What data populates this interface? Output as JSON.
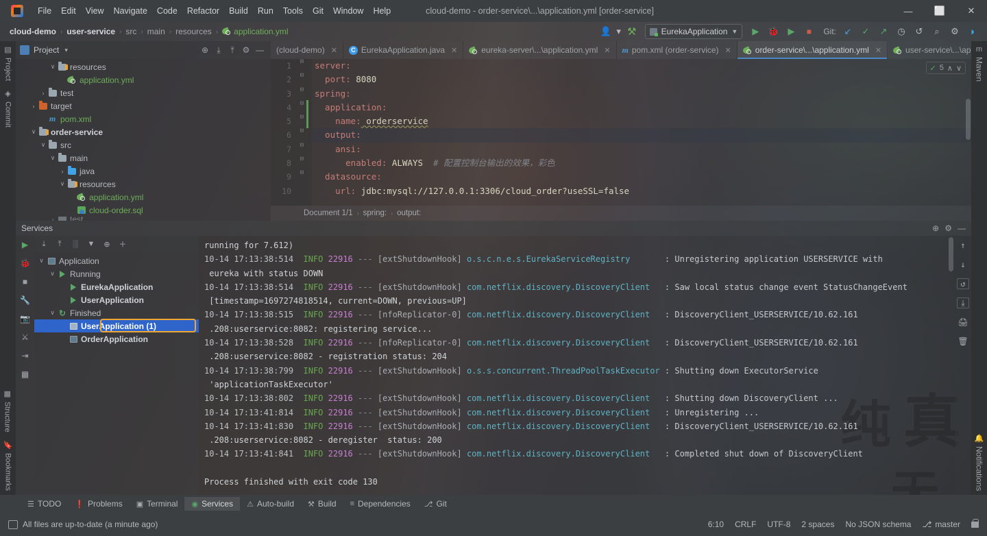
{
  "window": {
    "title": "cloud-demo - order-service\\...\\application.yml [order-service]",
    "minimize": "—",
    "maximize": "⬜",
    "close": "✕"
  },
  "menu": {
    "items": [
      "File",
      "Edit",
      "View",
      "Navigate",
      "Code",
      "Refactor",
      "Build",
      "Run",
      "Tools",
      "Git",
      "Window",
      "Help"
    ]
  },
  "navbar": {
    "breadcrumbs": [
      "cloud-demo",
      "user-service",
      "src",
      "main",
      "resources",
      "application.yml"
    ],
    "separator": "›",
    "run_config": "EurekaApplication",
    "run_config_caret": "▼",
    "git_label": "Git:",
    "icons": {
      "profile": "👤",
      "profile_caret": "▾",
      "hammer": "⚒",
      "run": "▶",
      "debug": "🐞",
      "run_coverage": "▶",
      "stop": "■",
      "update_project": "↙",
      "commit": "✓",
      "push": "↗",
      "history": "◷",
      "rollback": "↺",
      "search": "⌕",
      "settings": "⚙",
      "ide_widget": "◗"
    }
  },
  "left_strip": {
    "items": [
      {
        "label": "Project",
        "icon": "▤"
      },
      {
        "label": "Commit",
        "icon": "◈"
      },
      {
        "label": "Structure",
        "icon": "▦"
      },
      {
        "label": "Bookmarks",
        "icon": "🔖"
      }
    ]
  },
  "right_strip": {
    "items": [
      {
        "label": "Maven",
        "icon": "m"
      },
      {
        "label": "Notifications",
        "icon": "🔔"
      }
    ]
  },
  "project_panel": {
    "title": "Project",
    "caret": "▾",
    "header_icons": [
      "⊕",
      "⤓",
      "⤒",
      "⚙",
      "—"
    ],
    "tree": [
      {
        "indent": 3,
        "twist": "∨",
        "icon": "resources",
        "label": "resources",
        "style": "normal"
      },
      {
        "indent": 4,
        "twist": "",
        "icon": "yml",
        "label": "application.yml",
        "style": "green"
      },
      {
        "indent": 2,
        "twist": "›",
        "icon": "folder",
        "label": "test",
        "style": "normal"
      },
      {
        "indent": 1,
        "twist": "›",
        "icon": "folder-orange",
        "label": "target",
        "style": "normal"
      },
      {
        "indent": 2,
        "twist": "",
        "icon": "maven",
        "label": "pom.xml",
        "style": "green"
      },
      {
        "indent": 1,
        "twist": "∨",
        "icon": "module",
        "label": "order-service",
        "style": "bold"
      },
      {
        "indent": 2,
        "twist": "∨",
        "icon": "folder",
        "label": "src",
        "style": "normal"
      },
      {
        "indent": 3,
        "twist": "∨",
        "icon": "folder",
        "label": "main",
        "style": "normal"
      },
      {
        "indent": 4,
        "twist": "›",
        "icon": "folder-blue",
        "label": "java",
        "style": "normal"
      },
      {
        "indent": 4,
        "twist": "∨",
        "icon": "resources",
        "label": "resources",
        "style": "normal"
      },
      {
        "indent": 5,
        "twist": "",
        "icon": "yml",
        "label": "application.yml",
        "style": "green"
      },
      {
        "indent": 5,
        "twist": "",
        "icon": "sql",
        "label": "cloud-order.sql",
        "style": "green"
      },
      {
        "indent": 3,
        "twist": "›",
        "icon": "folder",
        "label": "test",
        "style": "clipped"
      }
    ]
  },
  "editor": {
    "tabs": [
      {
        "label": "(cloud-demo)",
        "icon": "none",
        "active": false,
        "close": "✕"
      },
      {
        "label": "EurekaApplication.java",
        "icon": "class",
        "active": false,
        "close": "✕"
      },
      {
        "label": "eureka-server\\...\\application.yml",
        "icon": "yml",
        "active": false,
        "close": "✕"
      },
      {
        "label": "pom.xml (order-service)",
        "icon": "maven",
        "active": false,
        "close": "✕"
      },
      {
        "label": "order-service\\...\\application.yml",
        "icon": "yml",
        "active": true,
        "close": "✕"
      },
      {
        "label": "user-service\\...\\application.yml",
        "icon": "yml",
        "active": false,
        "close": "✕"
      }
    ],
    "tab_overflow": "∨",
    "tab_more": "⋮",
    "inspection": {
      "check": "✓",
      "count": "5",
      "up": "∧",
      "down": "∨"
    },
    "line_numbers": [
      "1",
      "2",
      "3",
      "4",
      "5",
      "6",
      "7",
      "8",
      "9",
      "10"
    ],
    "code_lines": [
      {
        "indent": 0,
        "key": "server:",
        "value": "",
        "comment": "",
        "fold": "⊟",
        "highlight": false
      },
      {
        "indent": 1,
        "key": "port:",
        "value": " 8080",
        "comment": "",
        "fold": "⊟",
        "highlight": false
      },
      {
        "indent": 0,
        "key": "spring:",
        "value": "",
        "comment": "",
        "fold": "⊟",
        "highlight": false
      },
      {
        "indent": 1,
        "key": "application:",
        "value": "",
        "comment": "",
        "fold": "⊟",
        "highlight": false
      },
      {
        "indent": 2,
        "key": "name:",
        "value": " orderservice",
        "comment": "",
        "fold": "⊟",
        "underline": true,
        "highlight": false
      },
      {
        "indent": 1,
        "key": "output:",
        "value": "",
        "comment": "",
        "fold": "⊟",
        "highlight": true
      },
      {
        "indent": 2,
        "key": "ansi:",
        "value": "",
        "comment": "",
        "fold": "⊟",
        "highlight": false
      },
      {
        "indent": 3,
        "key": "enabled:",
        "value": " ALWAYS",
        "comment": "  # 配置控制台输出的效果，彩色",
        "fold": "⊟",
        "highlight": false
      },
      {
        "indent": 1,
        "key": "datasource:",
        "value": "",
        "comment": "",
        "fold": "⊟",
        "highlight": false
      },
      {
        "indent": 2,
        "key": "url:",
        "value": " jdbc:mysql://127.0.0.1:3306/cloud_order?useSSL=false",
        "comment": "",
        "fold": "",
        "highlight": false
      }
    ],
    "breadcrumb": [
      "Document 1/1",
      "spring:",
      "output:"
    ],
    "breadcrumb_sep": "›"
  },
  "services": {
    "title": "Services",
    "header_icons": [
      "⊕",
      "⚙",
      "—"
    ],
    "side_icons": [
      "▶",
      "🐞",
      "■",
      "🔧",
      "📷",
      "⚔",
      "⇥",
      "▦"
    ],
    "toolbar_icons": [
      "⤓",
      "⤒",
      "░",
      "▼",
      "⊕",
      "＋"
    ],
    "tree": [
      {
        "indent": 0,
        "twist": "∨",
        "icon": "app",
        "label": "Application",
        "style": "normal",
        "selected": false
      },
      {
        "indent": 1,
        "twist": "∨",
        "icon": "run",
        "label": "Running",
        "style": "normal",
        "selected": false
      },
      {
        "indent": 2,
        "twist": "",
        "icon": "run",
        "label": "EurekaApplication",
        "style": "bold",
        "selected": false
      },
      {
        "indent": 2,
        "twist": "",
        "icon": "run",
        "label": "UserApplication",
        "style": "bold",
        "selected": false
      },
      {
        "indent": 1,
        "twist": "∨",
        "icon": "finished",
        "label": "Finished",
        "style": "normal",
        "selected": false
      },
      {
        "indent": 2,
        "twist": "",
        "icon": "app-pale",
        "label": "UserApplication (1)",
        "style": "white",
        "selected": true
      },
      {
        "indent": 2,
        "twist": "",
        "icon": "app",
        "label": "OrderApplication",
        "style": "bold",
        "selected": false
      }
    ],
    "gutter_icons": [
      "↑",
      "↓",
      "↺",
      "⤓",
      "🖨",
      "🗑"
    ]
  },
  "console": {
    "lines": [
      {
        "type": "plain",
        "text": "running for 7.612)"
      },
      {
        "type": "log",
        "time": "10-14 17:13:38:514",
        "level": "INFO",
        "pid": "22916",
        "thread": "[extShutdownHook]",
        "cls": "o.s.c.n.e.s.EurekaServiceRegistry",
        "msg": ": Unregistering application USERSERVICE with"
      },
      {
        "type": "plain",
        "text": " eureka with status DOWN"
      },
      {
        "type": "log",
        "time": "10-14 17:13:38:514",
        "level": "INFO",
        "pid": "22916",
        "thread": "[extShutdownHook]",
        "cls": "com.netflix.discovery.DiscoveryClient",
        "msg": ": Saw local status change event StatusChangeEvent"
      },
      {
        "type": "plain",
        "text": " [timestamp=1697274818514, current=DOWN, previous=UP]"
      },
      {
        "type": "log",
        "time": "10-14 17:13:38:515",
        "level": "INFO",
        "pid": "22916",
        "thread": "[nfoReplicator-0]",
        "cls": "com.netflix.discovery.DiscoveryClient",
        "msg": ": DiscoveryClient_USERSERVICE/10.62.161"
      },
      {
        "type": "plain",
        "text": " .208:userservice:8082: registering service..."
      },
      {
        "type": "log",
        "time": "10-14 17:13:38:528",
        "level": "INFO",
        "pid": "22916",
        "thread": "[nfoReplicator-0]",
        "cls": "com.netflix.discovery.DiscoveryClient",
        "msg": ": DiscoveryClient_USERSERVICE/10.62.161"
      },
      {
        "type": "plain",
        "text": " .208:userservice:8082 - registration status: 204"
      },
      {
        "type": "log",
        "time": "10-14 17:13:38:799",
        "level": "INFO",
        "pid": "22916",
        "thread": "[extShutdownHook]",
        "cls": "o.s.s.concurrent.ThreadPoolTaskExecutor",
        "msg": ": Shutting down ExecutorService"
      },
      {
        "type": "plain",
        "text": " 'applicationTaskExecutor'"
      },
      {
        "type": "log",
        "time": "10-14 17:13:38:802",
        "level": "INFO",
        "pid": "22916",
        "thread": "[extShutdownHook]",
        "cls": "com.netflix.discovery.DiscoveryClient",
        "msg": ": Shutting down DiscoveryClient ..."
      },
      {
        "type": "log",
        "time": "10-14 17:13:41:814",
        "level": "INFO",
        "pid": "22916",
        "thread": "[extShutdownHook]",
        "cls": "com.netflix.discovery.DiscoveryClient",
        "msg": ": Unregistering ..."
      },
      {
        "type": "log",
        "time": "10-14 17:13:41:830",
        "level": "INFO",
        "pid": "22916",
        "thread": "[extShutdownHook]",
        "cls": "com.netflix.discovery.DiscoveryClient",
        "msg": ": DiscoveryClient_USERSERVICE/10.62.161"
      },
      {
        "type": "plain",
        "text": " .208:userservice:8082 - deregister  status: 200"
      },
      {
        "type": "log",
        "time": "10-14 17:13:41:841",
        "level": "INFO",
        "pid": "22916",
        "thread": "[extShutdownHook]",
        "cls": "com.netflix.discovery.DiscoveryClient",
        "msg": ": Completed shut down of DiscoveryClient"
      },
      {
        "type": "blank",
        "text": " "
      },
      {
        "type": "plain",
        "text": "Process finished with exit code 130"
      }
    ]
  },
  "bottom_bar": {
    "items": [
      {
        "label": "TODO",
        "icon": "☰",
        "active": false
      },
      {
        "label": "Problems",
        "icon": "❗",
        "active": false
      },
      {
        "label": "Terminal",
        "icon": "▣",
        "active": false
      },
      {
        "label": "Services",
        "icon": "◉",
        "active": true
      },
      {
        "label": "Auto-build",
        "icon": "⚠",
        "active": false
      },
      {
        "label": "Build",
        "icon": "⚒",
        "active": false
      },
      {
        "label": "Dependencies",
        "icon": "≡",
        "active": false
      },
      {
        "label": "Git",
        "icon": "⎇",
        "active": false
      }
    ]
  },
  "status_bar": {
    "message": "All files are up-to-date (a minute ago)",
    "caret_position": "6:10",
    "line_separator": "CRLF",
    "encoding": "UTF-8",
    "indent": "2 spaces",
    "schema": "No JSON schema",
    "branch": "master",
    "branch_icon": "⎇"
  },
  "wallpaper": {
    "char1": "纯",
    "char2": "真",
    "char3": "无"
  }
}
